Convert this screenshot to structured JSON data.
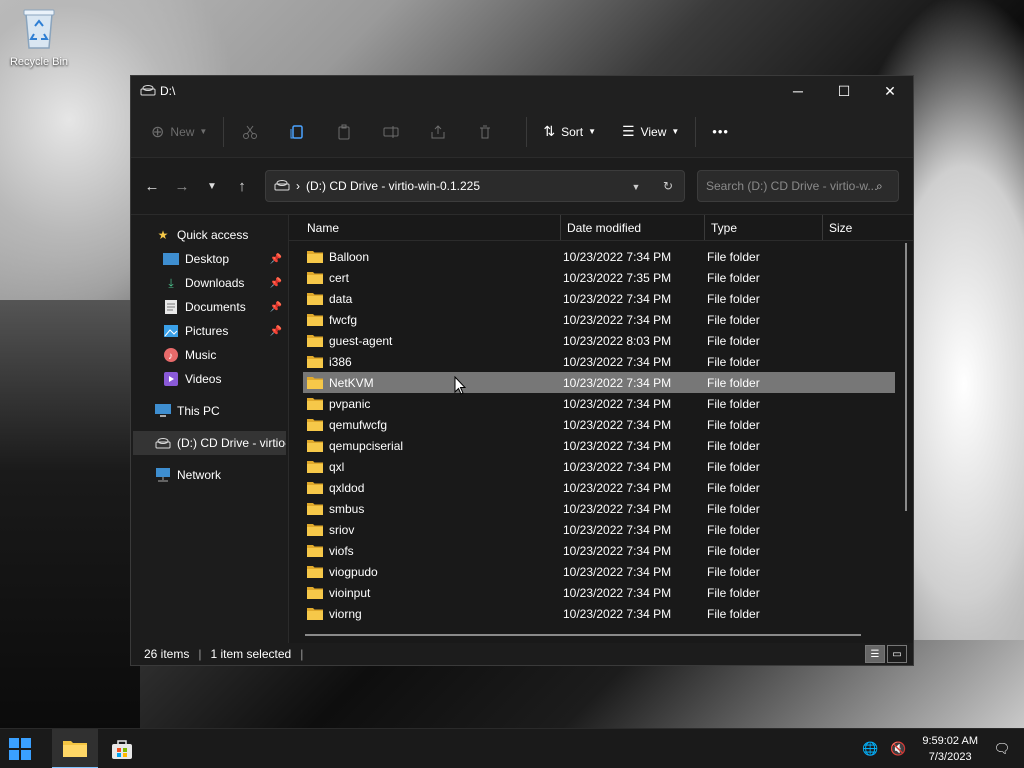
{
  "desktop": {
    "icons": [
      {
        "label": "Recycle Bin"
      }
    ]
  },
  "window": {
    "title": "D:\\",
    "controls": {
      "minimize": "─",
      "maximize": "☐",
      "close": "✕"
    }
  },
  "toolbar": {
    "new_label": "New",
    "sort_label": "Sort",
    "view_label": "View",
    "more_label": "•••"
  },
  "address": {
    "path": "(D:) CD Drive - virtio-win-0.1.225",
    "search_placeholder": "Search (D:) CD Drive - virtio-w..."
  },
  "sidebar": {
    "items": [
      {
        "label": "Quick access",
        "icon": "star-icon"
      },
      {
        "label": "Desktop",
        "icon": "desktop-icon",
        "pinned": true
      },
      {
        "label": "Downloads",
        "icon": "download-icon",
        "pinned": true
      },
      {
        "label": "Documents",
        "icon": "documents-icon",
        "pinned": true
      },
      {
        "label": "Pictures",
        "icon": "pictures-icon",
        "pinned": true
      },
      {
        "label": "Music",
        "icon": "music-icon"
      },
      {
        "label": "Videos",
        "icon": "videos-icon"
      },
      {
        "label": "This PC",
        "icon": "pc-icon"
      },
      {
        "label": "(D:) CD Drive - virtio-",
        "icon": "cd-drive-icon"
      },
      {
        "label": "Network",
        "icon": "network-icon"
      }
    ]
  },
  "columns": {
    "name": "Name",
    "date": "Date modified",
    "type": "Type",
    "size": "Size"
  },
  "files": [
    {
      "name": "Balloon",
      "date": "10/23/2022 7:34 PM",
      "type": "File folder"
    },
    {
      "name": "cert",
      "date": "10/23/2022 7:35 PM",
      "type": "File folder"
    },
    {
      "name": "data",
      "date": "10/23/2022 7:34 PM",
      "type": "File folder"
    },
    {
      "name": "fwcfg",
      "date": "10/23/2022 7:34 PM",
      "type": "File folder"
    },
    {
      "name": "guest-agent",
      "date": "10/23/2022 8:03 PM",
      "type": "File folder"
    },
    {
      "name": "i386",
      "date": "10/23/2022 7:34 PM",
      "type": "File folder"
    },
    {
      "name": "NetKVM",
      "date": "10/23/2022 7:34 PM",
      "type": "File folder",
      "selected": true
    },
    {
      "name": "pvpanic",
      "date": "10/23/2022 7:34 PM",
      "type": "File folder"
    },
    {
      "name": "qemufwcfg",
      "date": "10/23/2022 7:34 PM",
      "type": "File folder"
    },
    {
      "name": "qemupciserial",
      "date": "10/23/2022 7:34 PM",
      "type": "File folder"
    },
    {
      "name": "qxl",
      "date": "10/23/2022 7:34 PM",
      "type": "File folder"
    },
    {
      "name": "qxldod",
      "date": "10/23/2022 7:34 PM",
      "type": "File folder"
    },
    {
      "name": "smbus",
      "date": "10/23/2022 7:34 PM",
      "type": "File folder"
    },
    {
      "name": "sriov",
      "date": "10/23/2022 7:34 PM",
      "type": "File folder"
    },
    {
      "name": "viofs",
      "date": "10/23/2022 7:34 PM",
      "type": "File folder"
    },
    {
      "name": "viogpudo",
      "date": "10/23/2022 7:34 PM",
      "type": "File folder"
    },
    {
      "name": "vioinput",
      "date": "10/23/2022 7:34 PM",
      "type": "File folder"
    },
    {
      "name": "viorng",
      "date": "10/23/2022 7:34 PM",
      "type": "File folder"
    }
  ],
  "status": {
    "item_count": "26 items",
    "selection": "1 item selected"
  },
  "taskbar": {
    "time": "9:59:02 AM",
    "date": "7/3/2023"
  },
  "colors": {
    "folder": "#f4c542",
    "selected_row": "#777777",
    "accent": "#7fc4ff"
  }
}
